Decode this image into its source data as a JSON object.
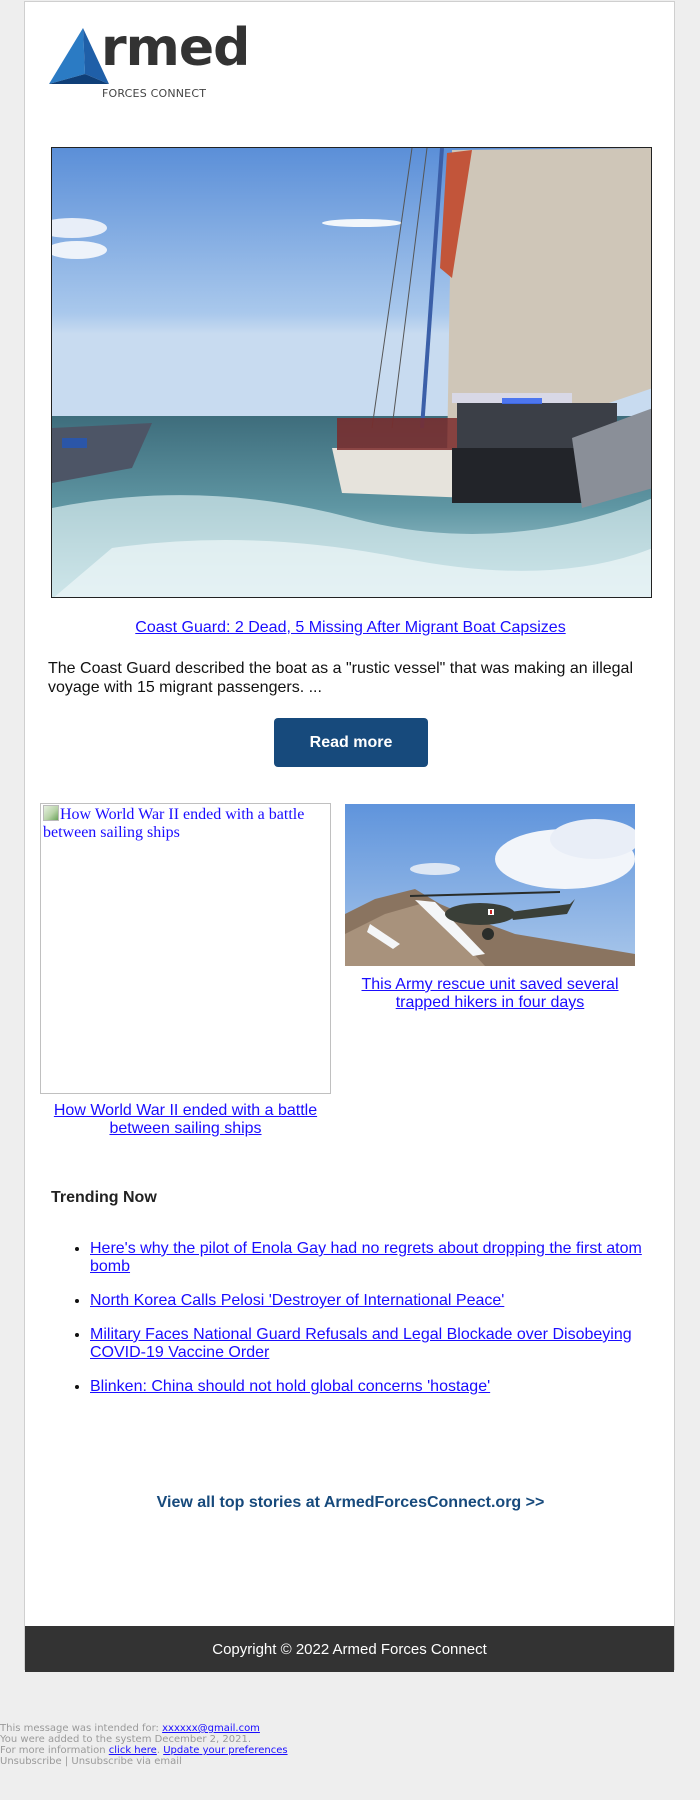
{
  "brand": {
    "logo_word": "rmed",
    "logo_sub": "FORCES CONNECT",
    "logo_alt": "Armed Forces Connect",
    "accent_color": "#174a7c",
    "triangle_colors": [
      "#1f5fa8",
      "#2b7bc4",
      "#0f3f78"
    ]
  },
  "hero": {
    "image_alt": "Coast Guard boats alongside migrant sailing vessel",
    "title": "Coast Guard: 2 Dead, 5 Missing After Migrant Boat Capsizes",
    "description": "The Coast Guard described the boat as a \"rustic vessel\" that was making an illegal voyage with 15 migrant passengers. ...",
    "button_label": "Read more"
  },
  "cards": [
    {
      "image_alt": "How World War II ended with a battle between sailing ships",
      "image_broken": true,
      "title": "How World War II ended with a battle between sailing ships"
    },
    {
      "image_alt": "Army helicopter over mountain ridge",
      "image_broken": false,
      "title": "This Army rescue unit saved several trapped hikers in four days"
    }
  ],
  "trending": {
    "heading": "Trending Now",
    "items": [
      "Here's why the pilot of Enola Gay had no regrets about dropping the first atom bomb",
      "North Korea Calls Pelosi 'Destroyer of International Peace'",
      "Military Faces National Guard Refusals and Legal Blockade over Disobeying COVID-19 Vaccine Order",
      "Blinken: China should not hold global concerns 'hostage'"
    ]
  },
  "view_all": "View all top stories at ArmedForcesConnect.org >>",
  "footer": {
    "copyright": "Copyright © 2022 Armed Forces Connect"
  },
  "meta": {
    "intended_prefix": "This message was intended for: ",
    "email": "xxxxxx@gmail.com",
    "added_line": "You were added to the system December 2, 2021.",
    "more_info_prefix": "For more information ",
    "click_here": "click here",
    "separator": ". ",
    "update_prefs": "Update your preferences",
    "unsubscribe": "Unsubscribe",
    "pipe": " | ",
    "unsubscribe_email": "Unsubscribe via email"
  }
}
